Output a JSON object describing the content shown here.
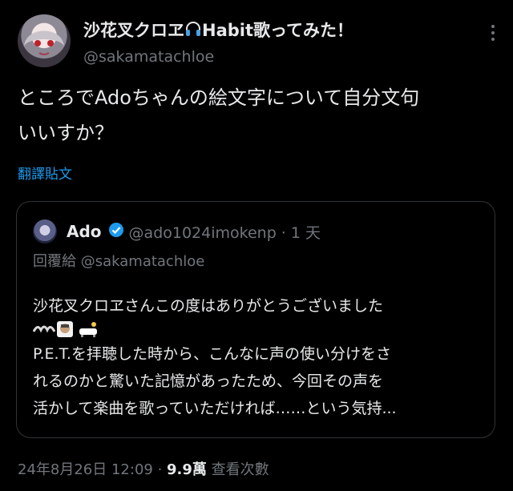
{
  "tweet": {
    "display_name": "沙花叉クロヱ",
    "display_name_suffix": "Habit歌ってみた！",
    "handle": "@sakamatachloe",
    "text_line1": "ところでAdoちゃんの絵文字について自分文句",
    "text_line2": "いいすか？",
    "translate_label": "翻譯貼文",
    "icons": {
      "headphone": "headphone-icon",
      "more": "more-icon"
    }
  },
  "quote": {
    "name": "Ado",
    "handle_time": "@ado1024imokenp · 1 天",
    "reply_prefix": "回覆給",
    "reply_handle": "@sakamatachloe",
    "line1": "沙花叉クロヱさんこの度はありがとうございました",
    "line2": "P.E.T.を拝聴した時から、こんなに声の使い分けをさ",
    "line3": "れるのかと驚いた記憶があったため、今回その声を",
    "line4": "活かして楽曲を歌っていただければ……という気持...",
    "emojis": [
      "wave-emoji",
      "ghost-emoji",
      "bathtub-emoji"
    ]
  },
  "meta": {
    "date": "24年8月26日 12:09 · ",
    "views_count": "9.9萬",
    "views_label": " 查看次數"
  },
  "colors": {
    "background": "#000000",
    "text": "#e7e9ea",
    "muted": "#71767b",
    "link": "#1d9bf0",
    "border": "#2f3336"
  }
}
